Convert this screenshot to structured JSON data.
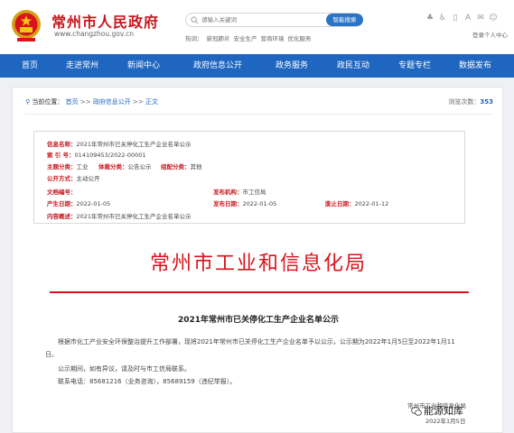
{
  "header": {
    "site_name": "常州市人民政府",
    "site_url": "www.changzhou.gov.cn",
    "search_placeholder": "请输入关键词",
    "search_button": "智能搜索",
    "hotwords_label": "热词：",
    "hotwords": [
      "新冠肺炎",
      "安全生产",
      "营商环境",
      "优化服务"
    ],
    "login": "登录个人中心",
    "icons": [
      "accessibility-icon",
      "wheelchair-icon",
      "mobile-icon",
      "font-size-icon",
      "mail-icon",
      "user-icon"
    ]
  },
  "nav": {
    "items": [
      "首页",
      "走进常州",
      "新闻中心",
      "政府信息公开",
      "政务服务",
      "政民互动",
      "专题专栏",
      "数据发布"
    ]
  },
  "breadcrumb": {
    "label": "当前位置：",
    "items": [
      "首页",
      "政府信息公开",
      "正文"
    ],
    "sep": ">>"
  },
  "views": {
    "label": "浏览次数：",
    "count": "353"
  },
  "info": {
    "name_label": "信息名称：",
    "name": "2021年常州市已关停化工生产企业名单公示",
    "index_label": "索 引 号：",
    "index": "014109453/2022-00001",
    "topic_label": "主题分类：",
    "topic": "工业",
    "genre_label": "体裁分类：",
    "genre": "公告公示",
    "org_label": "组配分类：",
    "org": "其他",
    "method_label": "公开方式：",
    "method": "主动公开",
    "docno_label": "文档编号：",
    "publisher_label": "发布机构：",
    "publisher": "市工信局",
    "created_label": "产生日期：",
    "created": "2022-01-05",
    "published_label": "发布日期：",
    "published": "2022-01-05",
    "abolish_label": "废止日期：",
    "abolish": "2022-01-12",
    "summary_label": "内容概述：",
    "summary": "2021年常州市已关停化工生产企业名单公示"
  },
  "document": {
    "org_title": "常州市工业和信息化局",
    "title": "2021年常州市已关停化工生产企业名单公示",
    "para1_line1": "根据市化工产业安全环保整治提升工作部署，现将2021年常州市已关停化工生产企业名单予以公示，公示期为2022年1月5日至2022年1月11",
    "para1_line2": "日。",
    "para2": "公示期间，如有异议，请及时与市工信局联系。",
    "para3": "联系电话：85681216（业务咨询），85689159（违纪举报）。",
    "signature": "常州市工业和信息化局",
    "date": "2022年1月5日"
  },
  "watermark": {
    "text": "能源知库"
  }
}
